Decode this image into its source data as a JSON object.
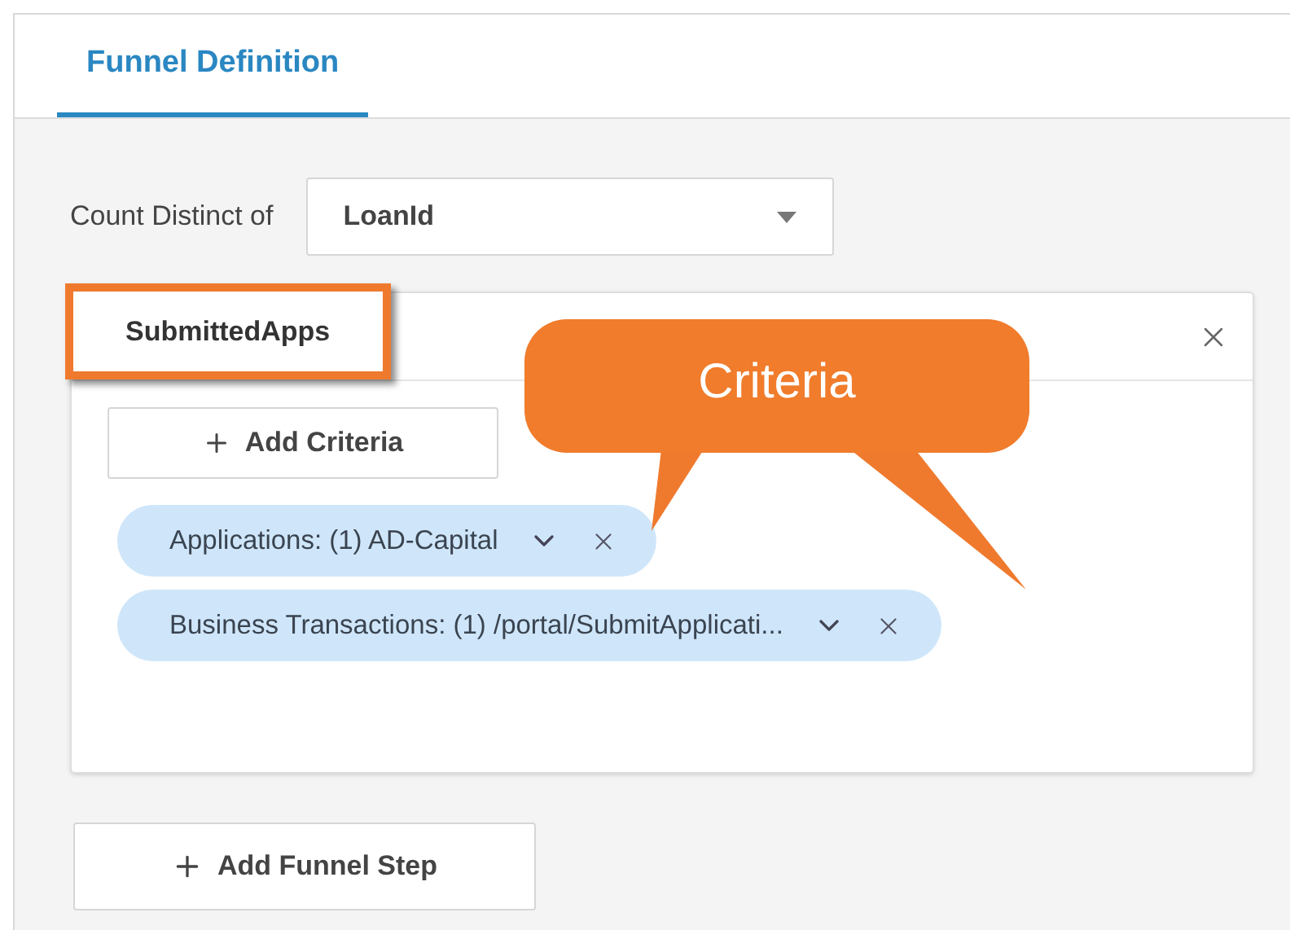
{
  "tabs": [
    {
      "label": "Funnel Definition",
      "selected": true
    }
  ],
  "count_distinct": {
    "label": "Count Distinct of",
    "value": "LoanId"
  },
  "steps": [
    {
      "name": "SubmittedApps",
      "highlighted": true,
      "add_criteria_label": "Add Criteria",
      "criteria": [
        {
          "text": "Applications: (1) AD-Capital"
        },
        {
          "text": "Business Transactions: (1) /portal/SubmitApplicati..."
        }
      ]
    }
  ],
  "add_step_label": "Add Funnel Step",
  "callout": {
    "text": "Criteria"
  }
}
